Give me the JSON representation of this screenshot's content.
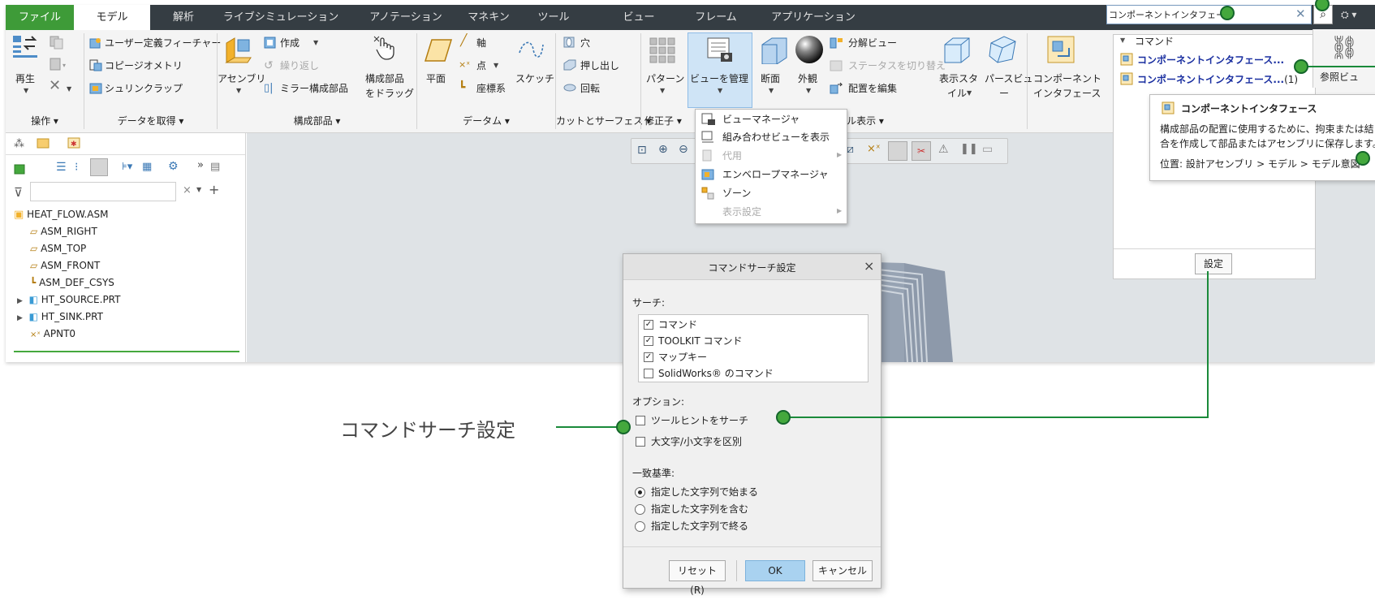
{
  "tabs": [
    {
      "label": "ファイル"
    },
    {
      "label": "モデル"
    },
    {
      "label": "解析"
    },
    {
      "label": "ライブシミュレーション"
    },
    {
      "label": "アノテーション"
    },
    {
      "label": "マネキン"
    },
    {
      "label": "ツール"
    },
    {
      "label": "ビュー"
    },
    {
      "label": "フレーム"
    },
    {
      "label": "アプリケーション"
    }
  ],
  "ribbon": {
    "operations": {
      "regen": "再生",
      "group": "操作 ▾"
    },
    "get_data": {
      "udf": "ユーザー定義フィーチャー",
      "copy_geom": "コピージオメトリ",
      "shrinkwrap": "シュリンクラップ",
      "group": "データを取得 ▾"
    },
    "components": {
      "assembly": "アセンブリ",
      "create": "作成",
      "repeat": "繰り返し",
      "mirror": "ミラー構成部品",
      "drag1": "構成部品",
      "drag2": "をドラッグ",
      "group": "構成部品 ▾"
    },
    "datum": {
      "plane": "平面",
      "axis": "軸",
      "point": "点",
      "csys": "座標系",
      "sketch": "スケッチ",
      "group": "データム ▾"
    },
    "cut": {
      "hole": "穴",
      "extrude": "押し出し",
      "revolve": "回転",
      "group": "カットとサーフェス ▾"
    },
    "modifiers": {
      "pattern": "パターン",
      "group": "修正子 ▾"
    },
    "view": {
      "manage": "ビューを管理",
      "section": "断面",
      "appearance": "外観",
      "explode": "分解ビュー",
      "toggle_status": "ステータスを切り替え",
      "edit_pos": "配置を編集",
      "display_style1": "表示スタ",
      "display_style2": "イル",
      "persp1": "パースビュ",
      "persp2": "ー",
      "group": "ル表示 ▾"
    },
    "comp_interface1": "コンポーネント",
    "comp_interface2": "インタフェース",
    "ref_view": "参照ビュ"
  },
  "search": {
    "value": "コンポーネントインタフェース",
    "section": "コマンド",
    "result1": "コンポーネントインタフェース...",
    "result2": "コンポーネントインタフェース...",
    "result2_count": "(1)",
    "settings_button": "設定"
  },
  "tooltip": {
    "title": "コンポーネントインタフェース",
    "desc1": "構成部品の配置に使用するために、拘束または結",
    "desc2": "合を作成して部品またはアセンブリに保存します。",
    "location": "位置: 設計アセンブリ > モデル > モデル意図"
  },
  "view_menu": {
    "items": [
      {
        "label": "ビューマネージャ",
        "enabled": true
      },
      {
        "label": "組み合わせビューを表示",
        "enabled": true
      },
      {
        "label": "代用",
        "enabled": false
      },
      {
        "label": "エンベロープマネージャ",
        "enabled": true
      },
      {
        "label": "ゾーン",
        "enabled": true
      },
      {
        "label": "表示設定",
        "enabled": false
      }
    ]
  },
  "tree": {
    "items": [
      "HEAT_FLOW.ASM",
      "ASM_RIGHT",
      "ASM_TOP",
      "ASM_FRONT",
      "ASM_DEF_CSYS",
      "HT_SOURCE.PRT",
      "HT_SINK.PRT",
      "APNT0"
    ]
  },
  "dialog": {
    "title": "コマンドサーチ設定",
    "close": "×",
    "search_label": "サーチ:",
    "search_items": [
      {
        "label": "コマンド",
        "checked": true
      },
      {
        "label": "TOOLKIT コマンド",
        "checked": true
      },
      {
        "label": "マップキー",
        "checked": true
      },
      {
        "label": "SolidWorks® のコマンド",
        "checked": false
      }
    ],
    "options_label": "オプション:",
    "options": [
      {
        "label": "ツールヒントをサーチ",
        "checked": false
      },
      {
        "label": "大文字/小文字を区別",
        "checked": false
      }
    ],
    "match_label": "一致基準:",
    "match_options": [
      {
        "label": "指定した文字列で始まる",
        "selected": true
      },
      {
        "label": "指定した文字列を含む",
        "selected": false
      },
      {
        "label": "指定した文字列で終る",
        "selected": false
      }
    ],
    "reset": "リセット (R)",
    "ok": "OK",
    "cancel": "キャンセル"
  },
  "callout_label": "コマンドサーチ設定",
  "colors": {
    "accent_green": "#3e9b38",
    "callout_green": "#1a8a3a",
    "link_blue": "#1a2fa0",
    "ok_blue": "#a9d2f0"
  }
}
